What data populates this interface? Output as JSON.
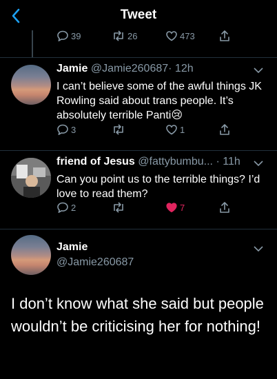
{
  "header": {
    "title": "Tweet"
  },
  "top_actions": {
    "replies": "39",
    "retweets": "26",
    "likes": "473"
  },
  "tweets": [
    {
      "name": "Jamie",
      "handle": "@Jamie260687",
      "time": "· 12h",
      "text": "I can’t believe some of the awful things JK Rowling said about trans people. It’s absolutely terrible Panti😢",
      "replies": "3",
      "retweets": "",
      "likes": "1"
    },
    {
      "name": "friend of Jesus",
      "handle": "@fattybumbu...",
      "time": "· 11h",
      "text": "Can you point us to the terrible things? I’d love to read them?",
      "replies": "2",
      "retweets": "",
      "likes": "7"
    }
  ],
  "main_tweet": {
    "name": "Jamie",
    "handle": "@Jamie260687",
    "text": "I don’t know what she said but people wouldn’t be criticising her for nothing!"
  },
  "colors": {
    "background": "#000000",
    "accent": "#1da1f2",
    "muted": "#8899a6",
    "like": "#e0245e"
  }
}
